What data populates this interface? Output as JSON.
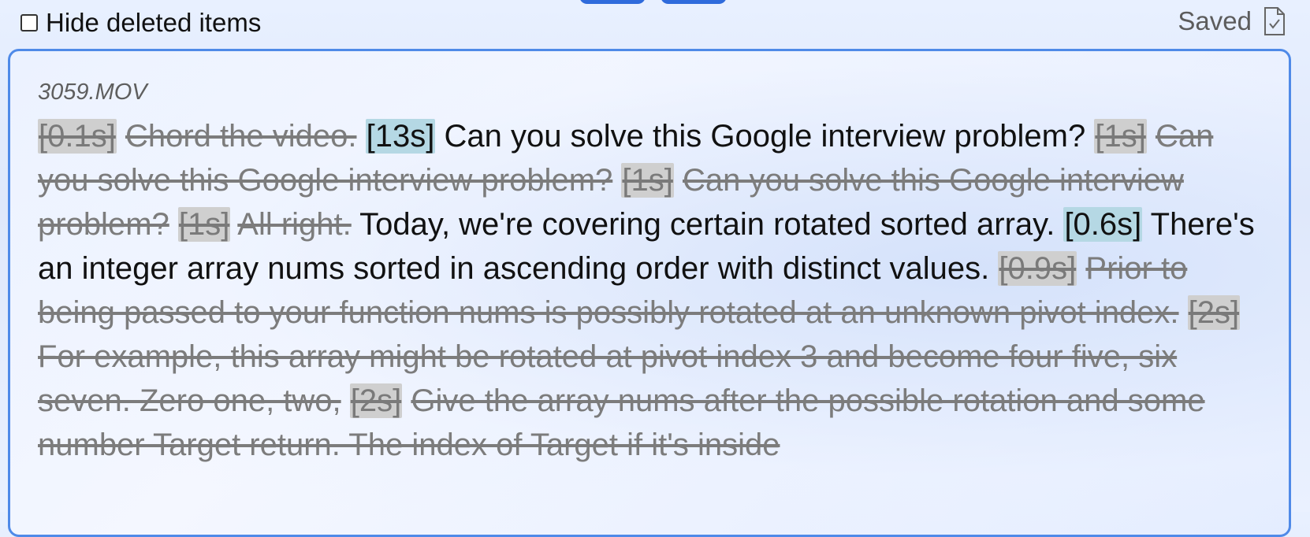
{
  "toolbar": {
    "hide_deleted_label": "Hide deleted items",
    "hide_deleted_checked": false,
    "status_text": "Saved",
    "status_icon": "document-check-icon"
  },
  "editor": {
    "filename": "3059.MOV",
    "segments": [
      {
        "timestamp": "[0.1s]",
        "text": "Chord the video.",
        "deleted": true
      },
      {
        "timestamp": "[13s]",
        "text": "Can you solve this Google interview problem?",
        "deleted": false
      },
      {
        "timestamp": "[1s]",
        "text": "Can you solve this Google interview problem?",
        "deleted": true
      },
      {
        "timestamp": "[1s]",
        "text": "Can you solve this Google interview problem?",
        "deleted": true
      },
      {
        "timestamp": "[1s]",
        "text": "All right.",
        "deleted": true
      },
      {
        "timestamp": "",
        "text": "Today, we're covering certain rotated sorted array.",
        "deleted": false
      },
      {
        "timestamp": "[0.6s]",
        "text": "There's an integer array nums sorted in ascending order with distinct values.",
        "deleted": false
      },
      {
        "timestamp": "[0.9s]",
        "text": "Prior to being passed to your function nums is possibly rotated at an unknown pivot index.",
        "deleted": true
      },
      {
        "timestamp": "[2s]",
        "text": "For example, this array might be rotated at pivot index 3 and become four five, six seven. Zero one, two,",
        "deleted": true
      },
      {
        "timestamp": "[2s]",
        "text": "Give the array nums after the possible rotation and some number Target return. The index of Target if it's inside",
        "deleted": true
      }
    ]
  },
  "colors": {
    "accent": "#4f8ae8",
    "kept_timestamp_bg": "#b5d8e4",
    "deleted_timestamp_bg": "#cfcfcf",
    "deleted_text": "#7c7c7c"
  }
}
